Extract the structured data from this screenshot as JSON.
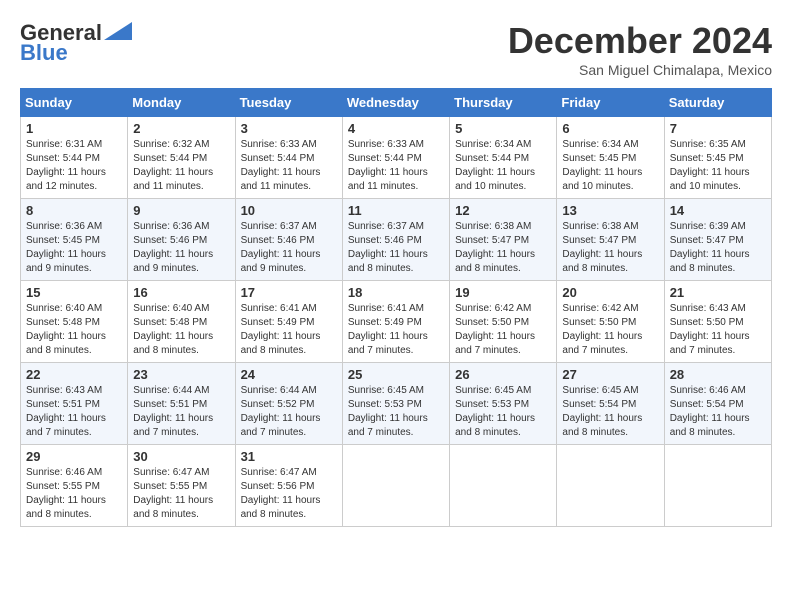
{
  "logo": {
    "line1": "General",
    "line2": "Blue"
  },
  "title": "December 2024",
  "location": "San Miguel Chimalapa, Mexico",
  "days_header": [
    "Sunday",
    "Monday",
    "Tuesday",
    "Wednesday",
    "Thursday",
    "Friday",
    "Saturday"
  ],
  "weeks": [
    [
      {
        "day": "1",
        "sunrise": "6:31 AM",
        "sunset": "5:44 PM",
        "daylight": "11 hours and 12 minutes."
      },
      {
        "day": "2",
        "sunrise": "6:32 AM",
        "sunset": "5:44 PM",
        "daylight": "11 hours and 11 minutes."
      },
      {
        "day": "3",
        "sunrise": "6:33 AM",
        "sunset": "5:44 PM",
        "daylight": "11 hours and 11 minutes."
      },
      {
        "day": "4",
        "sunrise": "6:33 AM",
        "sunset": "5:44 PM",
        "daylight": "11 hours and 11 minutes."
      },
      {
        "day": "5",
        "sunrise": "6:34 AM",
        "sunset": "5:44 PM",
        "daylight": "11 hours and 10 minutes."
      },
      {
        "day": "6",
        "sunrise": "6:34 AM",
        "sunset": "5:45 PM",
        "daylight": "11 hours and 10 minutes."
      },
      {
        "day": "7",
        "sunrise": "6:35 AM",
        "sunset": "5:45 PM",
        "daylight": "11 hours and 10 minutes."
      }
    ],
    [
      {
        "day": "8",
        "sunrise": "6:36 AM",
        "sunset": "5:45 PM",
        "daylight": "11 hours and 9 minutes."
      },
      {
        "day": "9",
        "sunrise": "6:36 AM",
        "sunset": "5:46 PM",
        "daylight": "11 hours and 9 minutes."
      },
      {
        "day": "10",
        "sunrise": "6:37 AM",
        "sunset": "5:46 PM",
        "daylight": "11 hours and 9 minutes."
      },
      {
        "day": "11",
        "sunrise": "6:37 AM",
        "sunset": "5:46 PM",
        "daylight": "11 hours and 8 minutes."
      },
      {
        "day": "12",
        "sunrise": "6:38 AM",
        "sunset": "5:47 PM",
        "daylight": "11 hours and 8 minutes."
      },
      {
        "day": "13",
        "sunrise": "6:38 AM",
        "sunset": "5:47 PM",
        "daylight": "11 hours and 8 minutes."
      },
      {
        "day": "14",
        "sunrise": "6:39 AM",
        "sunset": "5:47 PM",
        "daylight": "11 hours and 8 minutes."
      }
    ],
    [
      {
        "day": "15",
        "sunrise": "6:40 AM",
        "sunset": "5:48 PM",
        "daylight": "11 hours and 8 minutes."
      },
      {
        "day": "16",
        "sunrise": "6:40 AM",
        "sunset": "5:48 PM",
        "daylight": "11 hours and 8 minutes."
      },
      {
        "day": "17",
        "sunrise": "6:41 AM",
        "sunset": "5:49 PM",
        "daylight": "11 hours and 8 minutes."
      },
      {
        "day": "18",
        "sunrise": "6:41 AM",
        "sunset": "5:49 PM",
        "daylight": "11 hours and 7 minutes."
      },
      {
        "day": "19",
        "sunrise": "6:42 AM",
        "sunset": "5:50 PM",
        "daylight": "11 hours and 7 minutes."
      },
      {
        "day": "20",
        "sunrise": "6:42 AM",
        "sunset": "5:50 PM",
        "daylight": "11 hours and 7 minutes."
      },
      {
        "day": "21",
        "sunrise": "6:43 AM",
        "sunset": "5:50 PM",
        "daylight": "11 hours and 7 minutes."
      }
    ],
    [
      {
        "day": "22",
        "sunrise": "6:43 AM",
        "sunset": "5:51 PM",
        "daylight": "11 hours and 7 minutes."
      },
      {
        "day": "23",
        "sunrise": "6:44 AM",
        "sunset": "5:51 PM",
        "daylight": "11 hours and 7 minutes."
      },
      {
        "day": "24",
        "sunrise": "6:44 AM",
        "sunset": "5:52 PM",
        "daylight": "11 hours and 7 minutes."
      },
      {
        "day": "25",
        "sunrise": "6:45 AM",
        "sunset": "5:53 PM",
        "daylight": "11 hours and 7 minutes."
      },
      {
        "day": "26",
        "sunrise": "6:45 AM",
        "sunset": "5:53 PM",
        "daylight": "11 hours and 8 minutes."
      },
      {
        "day": "27",
        "sunrise": "6:45 AM",
        "sunset": "5:54 PM",
        "daylight": "11 hours and 8 minutes."
      },
      {
        "day": "28",
        "sunrise": "6:46 AM",
        "sunset": "5:54 PM",
        "daylight": "11 hours and 8 minutes."
      }
    ],
    [
      {
        "day": "29",
        "sunrise": "6:46 AM",
        "sunset": "5:55 PM",
        "daylight": "11 hours and 8 minutes."
      },
      {
        "day": "30",
        "sunrise": "6:47 AM",
        "sunset": "5:55 PM",
        "daylight": "11 hours and 8 minutes."
      },
      {
        "day": "31",
        "sunrise": "6:47 AM",
        "sunset": "5:56 PM",
        "daylight": "11 hours and 8 minutes."
      },
      null,
      null,
      null,
      null
    ]
  ],
  "labels": {
    "sunrise": "Sunrise:",
    "sunset": "Sunset:",
    "daylight": "Daylight:"
  }
}
